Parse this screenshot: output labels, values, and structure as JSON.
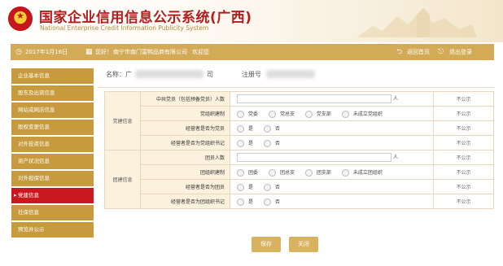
{
  "header": {
    "title": "国家企业信用信息公示系统(广西)",
    "subtitle": "National Enterprise Credit Information Publicity System"
  },
  "infobar": {
    "date": "2017年1月16日",
    "user_prefix": "您好！",
    "user_org": "南宁市南门富鸭品商有限公司",
    "user_suffix": "欢迎您",
    "home_label": "返回首页",
    "logout_label": "退出登录"
  },
  "sidebar": {
    "items": [
      {
        "label": "企业基本信息"
      },
      {
        "label": "股东及出资信息"
      },
      {
        "label": "网站或网店信息"
      },
      {
        "label": "股权变更信息"
      },
      {
        "label": "对外投资信息"
      },
      {
        "label": "资产状况信息"
      },
      {
        "label": "对外担保信息"
      },
      {
        "label": "党建信息"
      },
      {
        "label": "社保信息"
      },
      {
        "label": "预览并公示"
      }
    ]
  },
  "company": {
    "name_label": "名称：",
    "name_fragment": "广",
    "suffix_fragment": "司",
    "reg_label": "注册号"
  },
  "form": {
    "party_group": "党建信息",
    "league_group": "团建信息",
    "unit": "人",
    "not_public": "不公示",
    "rows": {
      "party_members": "中共党员（包括预备党员）人数",
      "party_org": "党组织建制",
      "mgr_party_member": "经营者是否为党员",
      "mgr_party_secretary": "经营者是否为党组织书记",
      "league_members": "团员人数",
      "league_org": "团组织建制",
      "mgr_league_member": "经营者是否为团员",
      "mgr_league_secretary": "经营者是否为团组织书记"
    },
    "party_options": [
      "党委",
      "党总支",
      "党支部",
      "未成立党组织"
    ],
    "league_options": [
      "团委",
      "团总支",
      "团支部",
      "未成立团组织"
    ],
    "yes": "是",
    "no": "否"
  },
  "buttons": {
    "save": "保存",
    "close": "关闭"
  },
  "colors": {
    "brand_red": "#b51b1b",
    "gold": "#d3aa55",
    "sidebar_gold": "#c69a3d",
    "active_red": "#c9181d"
  }
}
